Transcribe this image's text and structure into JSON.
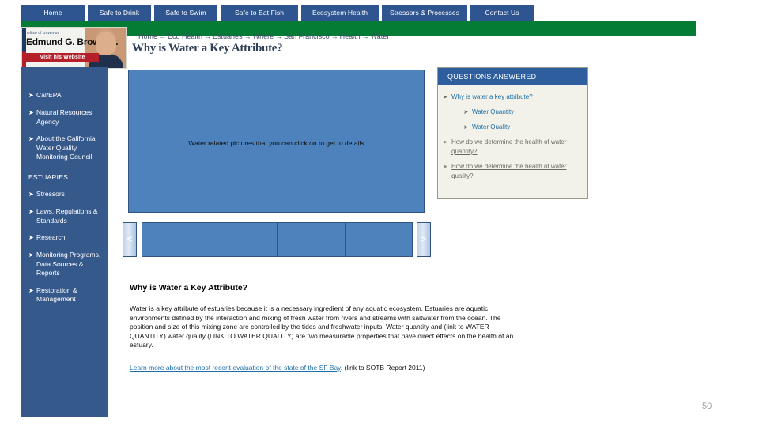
{
  "topnav": {
    "tabs": [
      {
        "label": "Home"
      },
      {
        "label": "Safe to Drink"
      },
      {
        "label": "Safe to Swim"
      },
      {
        "label": "Safe to Eat Fish"
      },
      {
        "label": "Ecosystem Health"
      },
      {
        "label": "Stressors & Processes"
      },
      {
        "label": "Contact Us"
      }
    ]
  },
  "gov_banner": {
    "office_label": "Office of Governor",
    "name": "Edmund G. Brown Jr.",
    "button_label": "Visit his Website"
  },
  "breadcrumb": {
    "separator": "→",
    "items": [
      "Home",
      "Eco Health",
      "Estuaries",
      "Where",
      "San Francisco",
      "Health",
      "Water"
    ]
  },
  "page_title": "Why is Water a Key Attribute?",
  "sidebar": {
    "bullet": "➤",
    "items": [
      {
        "label": "Cal/EPA"
      },
      {
        "label": "Natural Resources Agency"
      },
      {
        "label": "About the California Water Quality Monitoring Council"
      }
    ],
    "section_heading": "ESTUARIES",
    "section_items": [
      {
        "label": "Stressors"
      },
      {
        "label": "Laws, Regulations & Standards"
      },
      {
        "label": "Research"
      },
      {
        "label": "Monitoring Programs, Data Sources & Reports"
      },
      {
        "label": "Restoration & Management"
      }
    ]
  },
  "hero": {
    "caption": "Water related pictures that you can click on to get to details"
  },
  "carousel": {
    "prev_label": "<",
    "next_label": ">",
    "thumb_count": 4
  },
  "body": {
    "heading": "Why is Water a Key Attribute?",
    "paragraph": "Water is a key attribute of estuaries because it is a necessary ingredient of any aquatic ecosystem.  Estuaries are aquatic environments defined by the interaction and mixing of fresh water from rivers and streams with saltwater from the ocean.  The position and size of this mixing zone are controlled by the tides and freshwater inputs.  Water quantity and (link to WATER QUANTITY) water quality (LINK TO WATER QUALITY) are two measurable properties that have direct effects on the health of an estuary.",
    "link_text": "Learn more about the most recent evaluation of the state of the SF Bay",
    "link_suffix": ". (link to SOTB Report 2011)"
  },
  "questions_panel": {
    "header": "QUESTIONS ANSWERED",
    "bullet": "➤",
    "items": [
      {
        "label": "Why is water a key attribute?",
        "indent": false,
        "muted": false
      },
      {
        "label": "Water Quantity",
        "indent": true,
        "muted": false
      },
      {
        "label": "Water Quality",
        "indent": true,
        "muted": false
      },
      {
        "label": "How do we determine the health of water quantity?",
        "indent": false,
        "muted": true
      },
      {
        "label": "How do we determine the health of water quality?",
        "indent": false,
        "muted": true
      }
    ]
  },
  "page_number": "50",
  "colors": {
    "nav_blue": "#2e5590",
    "green_bar": "#047c35",
    "sidebar_blue": "#36598c",
    "panel_header_blue": "#2f5e9e",
    "image_blue": "#4e82bd",
    "link_blue": "#1d6ea8"
  }
}
